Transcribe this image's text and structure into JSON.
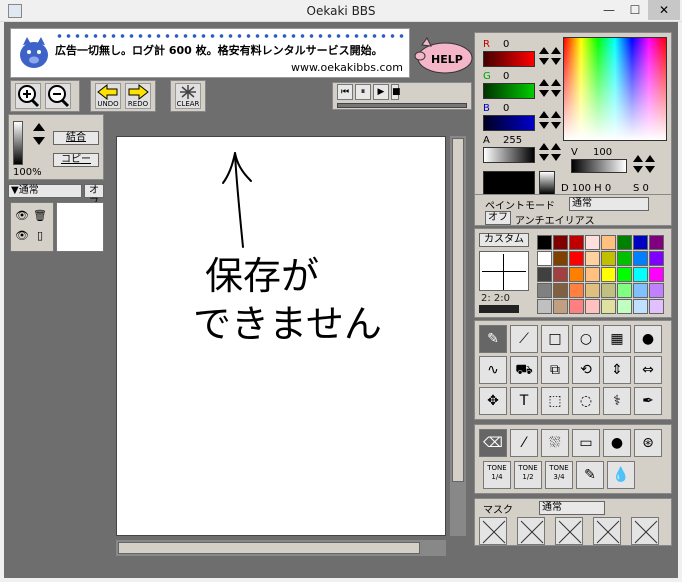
{
  "window": {
    "title": "Oekaki BBS",
    "min": "—",
    "max": "☐",
    "close": "✕"
  },
  "banner": {
    "ad_text": "広告一切無し。ログ計 600 枚。格安有料レンタルサービス開始。",
    "url": "www.oekakibbs.com",
    "help": "HELP"
  },
  "toolbar": {
    "zoom_in": "+",
    "zoom_out": "−",
    "undo": "UNDO",
    "redo": "REDO",
    "clear": "CLEAR"
  },
  "player": {
    "rewind": "⏮",
    "pause": "⏸",
    "play": "▶",
    "step": "■"
  },
  "left": {
    "merge": "結合",
    "copy": "コピー",
    "zoom": "100%",
    "layer_mode": "▼通常",
    "layer_visible": "オフ"
  },
  "canvas": {
    "arrow_label": "↑",
    "text_line1": "保存が",
    "text_line2": "できません"
  },
  "color": {
    "r_label": "R",
    "r": "0",
    "g_label": "G",
    "g": "0",
    "b_label": "B",
    "b": "0",
    "a_label": "A",
    "a": "255",
    "v_label": "V",
    "v": "100",
    "dhs": "D 100 H 0",
    "s": "S 0",
    "r_color": "#c00000",
    "g_color": "#00a000",
    "b_color": "#0000c0"
  },
  "paint": {
    "mode_label": "ペイントモード",
    "mode_value": "通常",
    "aa_toggle": "オフ",
    "aa_label": "アンチエイリアス"
  },
  "palette": {
    "custom": "カスタム",
    "size_label": "2: 2:0",
    "colors": [
      "#000000",
      "#800000",
      "#c00000",
      "#ffdede",
      "#ffc080",
      "#008000",
      "#0000c0",
      "#800080",
      "#ffffff",
      "#804000",
      "#ff0000",
      "#ffd0a0",
      "#c0c000",
      "#00c000",
      "#0080ff",
      "#8000ff",
      "#404040",
      "#a04040",
      "#ff8000",
      "#ffc080",
      "#ffff00",
      "#00ff00",
      "#00ffff",
      "#ff00ff",
      "#808080",
      "#806040",
      "#ff8040",
      "#e0c080",
      "#c0c080",
      "#80ff80",
      "#80c0ff",
      "#c080ff",
      "#c0c0c0",
      "#c0a080",
      "#ff8080",
      "#ffc0c0",
      "#e0e0a0",
      "#c0ffc0",
      "#c0e0ff",
      "#e0c0ff"
    ]
  },
  "tools": {
    "row1": [
      "pen-icon",
      "polyline-icon",
      "rect-icon",
      "circle-icon",
      "filled-rect-icon",
      "filled-circle-icon"
    ],
    "row2": [
      "curve-icon",
      "fill-icon",
      "copy-icon",
      "rotate-icon",
      "flip-v-icon",
      "flip-h-icon"
    ],
    "row3": [
      "move-icon",
      "text-icon",
      "select-icon",
      "lasso-icon",
      "wand-icon",
      "dropper-icon"
    ],
    "brush_row1": [
      "eraser-icon",
      "brush-icon",
      "spray-icon",
      "light-eraser-icon",
      "dot-icon",
      "smudge-icon"
    ],
    "tone1": "TONE 1/4",
    "tone2": "TONE 1/2",
    "tone3": "TONE 3/4"
  },
  "mask": {
    "label": "マスク",
    "value": "通常"
  }
}
